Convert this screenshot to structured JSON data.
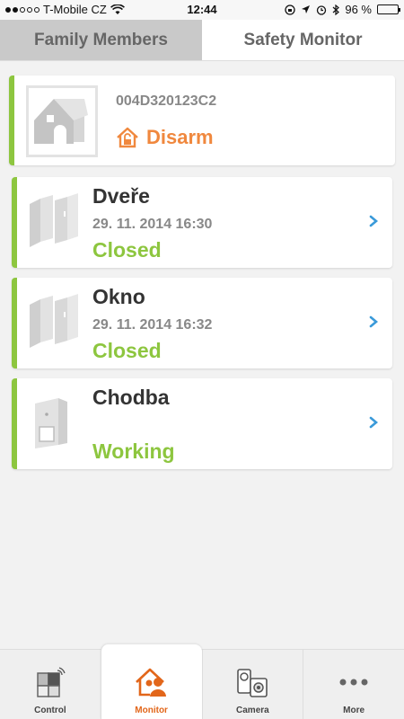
{
  "status_bar": {
    "carrier": "T-Mobile CZ",
    "time": "12:44",
    "battery": "96 %",
    "battery_level": 0.96
  },
  "top_tabs": [
    {
      "label": "Family Members",
      "active": true
    },
    {
      "label": "Safety Monitor",
      "active": false
    }
  ],
  "hub": {
    "id": "004D320123C2",
    "status": "Disarm",
    "status_color": "#f0883e"
  },
  "sensors": [
    {
      "name": "Dveře",
      "time": "29. 11. 2014 16:30",
      "state": "Closed",
      "icon": "door-sensor-icon"
    },
    {
      "name": "Okno",
      "time": "29. 11. 2014 16:32",
      "state": "Closed",
      "icon": "window-sensor-icon"
    },
    {
      "name": "Chodba",
      "time": "",
      "state": "Working",
      "icon": "motion-sensor-icon"
    }
  ],
  "bottom_tabs": [
    {
      "label": "Control",
      "icon": "control-icon",
      "active": false
    },
    {
      "label": "Monitor",
      "icon": "monitor-icon",
      "active": true
    },
    {
      "label": "Camera",
      "icon": "camera-icon",
      "active": false
    },
    {
      "label": "More",
      "icon": "more-icon",
      "active": false
    }
  ],
  "colors": {
    "accent_green": "#8dc63f",
    "accent_orange": "#e2661a",
    "chevron_blue": "#3a9ad9"
  }
}
